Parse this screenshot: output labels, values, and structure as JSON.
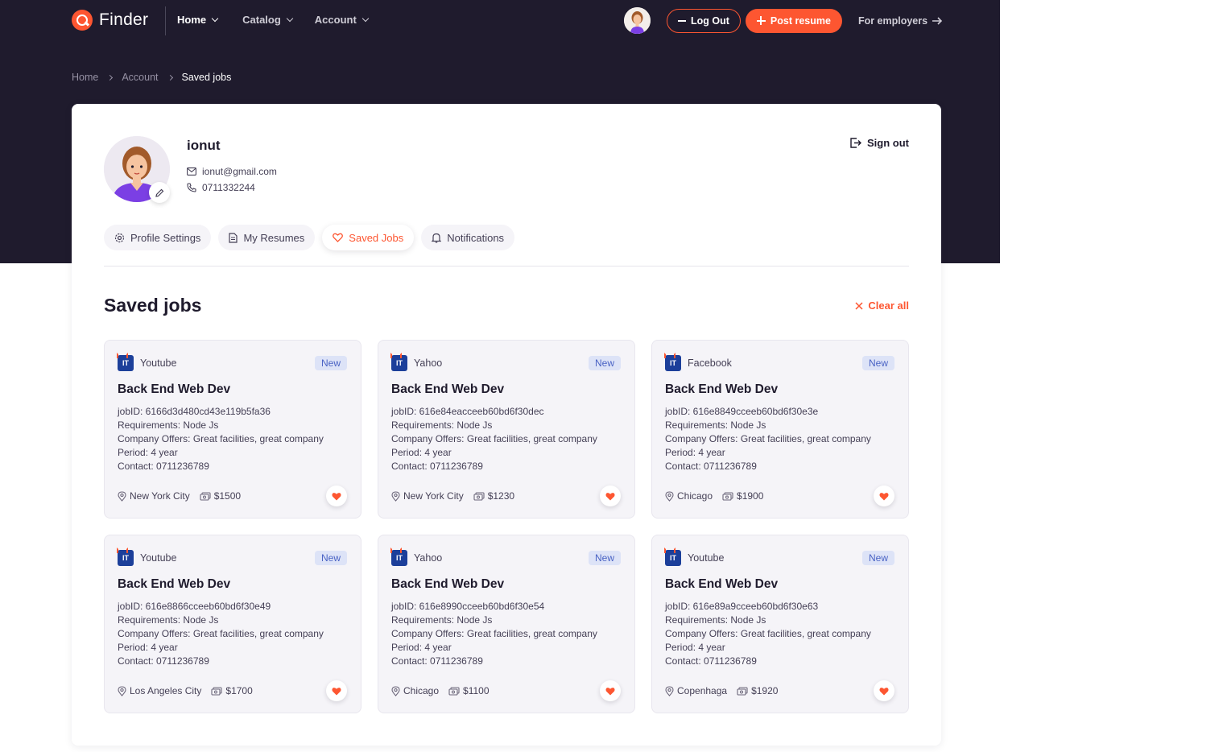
{
  "nav": {
    "logo_text": "Finder",
    "links": [
      {
        "label": "Home",
        "active": true
      },
      {
        "label": "Catalog",
        "active": false
      },
      {
        "label": "Account",
        "active": false
      }
    ],
    "logout_label": "Log Out",
    "post_label": "Post resume",
    "employers_label": "For employers"
  },
  "breadcrumb": [
    "Home",
    "Account",
    "Saved jobs"
  ],
  "profile": {
    "name": "ionut",
    "email": "ionut@gmail.com",
    "phone": "0711332244",
    "sign_out_label": "Sign out"
  },
  "tabs": [
    {
      "label": "Profile Settings",
      "icon": "gear-icon",
      "active": false
    },
    {
      "label": "My Resumes",
      "icon": "document-icon",
      "active": false
    },
    {
      "label": "Saved Jobs",
      "icon": "heart-icon",
      "active": true
    },
    {
      "label": "Notifications",
      "icon": "bell-icon",
      "active": false
    }
  ],
  "section": {
    "title": "Saved jobs",
    "clear_label": "Clear all"
  },
  "jobs": [
    {
      "company": "Youtube",
      "badge": "New",
      "title": "Back End Web Dev",
      "job_id": "jobID: 6166d3d480cd43e119b5fa36",
      "requirements": "Requirements: Node Js",
      "offers": "Company Offers: Great facilities, great company",
      "period": "Period: 4 year",
      "contact": "Contact: 0711236789",
      "city": "New York City",
      "salary": "$1500"
    },
    {
      "company": "Yahoo",
      "badge": "New",
      "title": "Back End Web Dev",
      "job_id": "jobID: 616e84eacceeb60bd6f30dec",
      "requirements": "Requirements: Node Js",
      "offers": "Company Offers: Great facilities, great company",
      "period": "Period: 4 year",
      "contact": "Contact: 0711236789",
      "city": "New York City",
      "salary": "$1230"
    },
    {
      "company": "Facebook",
      "badge": "New",
      "title": "Back End Web Dev",
      "job_id": "jobID: 616e8849cceeb60bd6f30e3e",
      "requirements": "Requirements: Node Js",
      "offers": "Company Offers: Great facilities, great company",
      "period": "Period: 4 year",
      "contact": "Contact: 0711236789",
      "city": "Chicago",
      "salary": "$1900"
    },
    {
      "company": "Youtube",
      "badge": "New",
      "title": "Back End Web Dev",
      "job_id": "jobID: 616e8866cceeb60bd6f30e49",
      "requirements": "Requirements: Node Js",
      "offers": "Company Offers: Great facilities, great company",
      "period": "Period: 4 year",
      "contact": "Contact: 0711236789",
      "city": "Los Angeles City",
      "salary": "$1700"
    },
    {
      "company": "Yahoo",
      "badge": "New",
      "title": "Back End Web Dev",
      "job_id": "jobID: 616e8990cceeb60bd6f30e54",
      "requirements": "Requirements: Node Js",
      "offers": "Company Offers: Great facilities, great company",
      "period": "Period: 4 year",
      "contact": "Contact: 0711236789",
      "city": "Chicago",
      "salary": "$1100"
    },
    {
      "company": "Youtube",
      "badge": "New",
      "title": "Back End Web Dev",
      "job_id": "jobID: 616e89a9cceeb60bd6f30e63",
      "requirements": "Requirements: Node Js",
      "offers": "Company Offers: Great facilities, great company",
      "period": "Period: 4 year",
      "contact": "Contact: 0711236789",
      "city": "Copenhaga",
      "salary": "$1920"
    }
  ],
  "colors": {
    "brand": "#fd5631",
    "dark": "#1f1b2d",
    "badge_bg": "#dde3f7",
    "badge_text": "#4a63c4"
  }
}
